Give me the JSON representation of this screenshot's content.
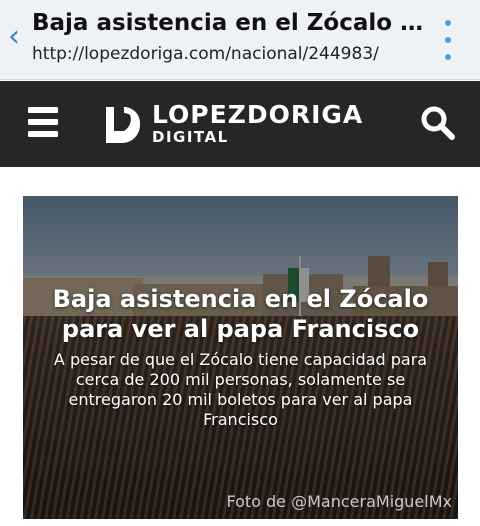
{
  "browser": {
    "title": "Baja asistencia en el Zócalo para ver al papa Francisco",
    "url": "http://lopezdoriga.com/nacional/244983/",
    "back_icon": "chevron-left-icon",
    "menu_icon": "kebab-menu-icon",
    "accent_color": "#3ea3dc"
  },
  "site": {
    "logo_line1": "LOPEZDORIGA",
    "logo_line2": "DIGITAL",
    "header_color": "#262626",
    "menu_icon": "hamburger-icon",
    "search_icon": "search-icon"
  },
  "article": {
    "headline": "Baja asistencia en el Zócalo para ver al papa Francisco",
    "summary": "A pesar de que el Zócalo tiene capacidad para cerca de 200 mil personas, solamente se entregaron 20 mil boletos para ver al papa Francisco",
    "photo_credit": "Foto de @ManceraMiguelMx"
  }
}
